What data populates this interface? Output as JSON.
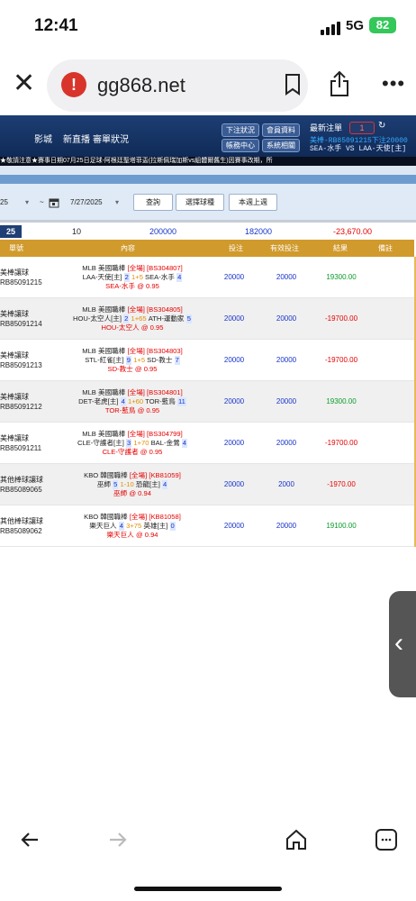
{
  "status_bar": {
    "time": "12:41",
    "network": "5G",
    "battery": "82"
  },
  "browser": {
    "url": "gg868.net",
    "warning_glyph": "!",
    "more_glyph": "•••",
    "close_glyph": "✕"
  },
  "site_header": {
    "nav": [
      "影城",
      "新直播",
      "審單狀況"
    ],
    "buttons": [
      "下注狀況",
      "會員資料",
      "帳務中心",
      "系統相關"
    ],
    "latest_label": "最新注單",
    "latest_count": "1",
    "latest_line1": "美棒-RB85091215下注20000",
    "latest_line2": "SEA-水手 VS LAA-天使[主]",
    "marquee": "★敬請注意★賽事日期07月25日足球-阿根廷聖塔菲盃(拉斯佩瑞加斯vs組體爾舊生)因賽事改期，所"
  },
  "filter": {
    "start_date_partial": "25",
    "tilde": "~",
    "end_date": "7/27/2025",
    "query_button": "查詢",
    "choose_button": "選擇球種",
    "lastweek_button": "本週上週"
  },
  "summary": {
    "date": "25",
    "count": "10",
    "bet_total": "200000",
    "valid_total": "182000",
    "result_total": "-23,670.00"
  },
  "table": {
    "headers": [
      "單號",
      "內容",
      "投注",
      "有效投注",
      "結果",
      "備註"
    ],
    "rows": [
      {
        "type": "美棒讓球",
        "id": "RB85091215",
        "league": "MLB 美國職棒",
        "scope": "[全場]",
        "code": "[BS304807]",
        "home": "LAA-天使[主]",
        "hs": "2",
        "line": "1+5",
        "away": "SEA-水手",
        "as": "4",
        "pick": "SEA-水手",
        "odds": "@ 0.95",
        "bet": "20000",
        "valid": "20000",
        "result": "19300.00",
        "win": true
      },
      {
        "type": "美棒讓球",
        "id": "RB85091214",
        "league": "MLB 美國職棒",
        "scope": "[全場]",
        "code": "[BS304805]",
        "home": "HOU-太空人[主]",
        "hs": "2",
        "line": "1+65",
        "away": "ATH-運動家",
        "as": "5",
        "pick": "HOU-太空人",
        "odds": "@ 0.95",
        "bet": "20000",
        "valid": "20000",
        "result": "-19700.00",
        "win": false
      },
      {
        "type": "美棒讓球",
        "id": "RB85091213",
        "league": "MLB 美國職棒",
        "scope": "[全場]",
        "code": "[BS304803]",
        "home": "STL-紅雀[主]",
        "hs": "9",
        "line": "1+5",
        "away": "SD-教士",
        "as": "7",
        "pick": "SD-教士",
        "odds": "@ 0.95",
        "bet": "20000",
        "valid": "20000",
        "result": "-19700.00",
        "win": false
      },
      {
        "type": "美棒讓球",
        "id": "RB85091212",
        "league": "MLB 美國職棒",
        "scope": "[全場]",
        "code": "[BS304801]",
        "home": "DET-老虎[主]",
        "hs": "4",
        "line": "1+60",
        "away": "TOR-藍鳥",
        "as": "11",
        "pick": "TOR-藍鳥",
        "odds": "@ 0.95",
        "bet": "20000",
        "valid": "20000",
        "result": "19300.00",
        "win": true
      },
      {
        "type": "美棒讓球",
        "id": "RB85091211",
        "league": "MLB 美國職棒",
        "scope": "[全場]",
        "code": "[BS304799]",
        "home": "CLE-守護者[主]",
        "hs": "3",
        "line": "1+70",
        "away": "BAL-金鶯",
        "as": "4",
        "pick": "CLE-守護者",
        "odds": "@ 0.95",
        "bet": "20000",
        "valid": "20000",
        "result": "-19700.00",
        "win": false
      },
      {
        "type": "其他棒球讓球",
        "id": "RB85089065",
        "league": "KBO 韓國職棒",
        "scope": "[全場]",
        "code": "[KB81059]",
        "home": "巫師",
        "hs": "5",
        "line": "1-10",
        "away": "恐龍[主]",
        "as": "4",
        "pick": "巫師",
        "odds": "@ 0.94",
        "bet": "20000",
        "valid": "2000",
        "result": "-1970.00",
        "win": false
      },
      {
        "type": "其他棒球讓球",
        "id": "RB85089062",
        "league": "KBO 韓國職棒",
        "scope": "[全場]",
        "code": "[KB81058]",
        "home": "樂天巨人",
        "hs": "4",
        "line": "3+75",
        "away": "英雄[主]",
        "as": "0",
        "pick": "樂天巨人",
        "odds": "@ 0.94",
        "bet": "20000",
        "valid": "20000",
        "result": "19100.00",
        "win": true
      }
    ]
  },
  "colors": {
    "header_bg": "#0f2a56",
    "table_header": "#d09a2c",
    "win": "#0a9c2a",
    "loss": "#e60000",
    "link": "#1733c9"
  },
  "icons": [
    "bookmark-icon",
    "share-icon",
    "calendar-icon",
    "back-arrow-icon",
    "forward-arrow-icon",
    "home-icon",
    "tabs-icon",
    "chevron-left-icon"
  ]
}
